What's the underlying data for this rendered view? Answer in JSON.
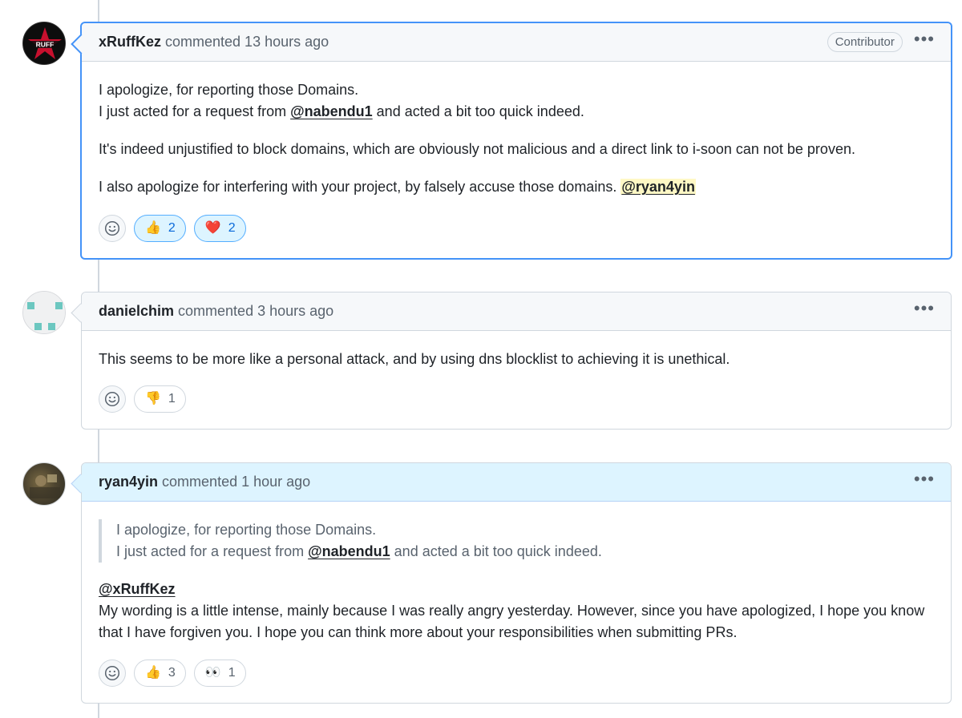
{
  "comments": [
    {
      "author": "xRuffKez",
      "meta": "commented 13 hours ago",
      "badge": "Contributor",
      "avatar_text": "RUFF",
      "lines": {
        "p1_line1": "I apologize, for reporting those Domains.",
        "p1_line2_pre": "I just acted for a request from ",
        "p1_mention": "@nabendu1",
        "p1_line2_post": " and acted a bit too quick indeed.",
        "p2": "It's indeed unjustified to block domains, which are obviously not malicious and a direct link to i-soon can not be proven.",
        "p3_pre": "I also apologize for interfering with your project, by falsely accuse those domains. ",
        "p3_mention": "@ryan4yin"
      },
      "reactions": [
        {
          "emoji": "👍",
          "count": "2"
        },
        {
          "emoji": "❤️",
          "count": "2"
        }
      ]
    },
    {
      "author": "danielchim",
      "meta": "commented 3 hours ago",
      "lines": {
        "p1": "This seems to be more like a personal attack, and by using dns blocklist to achieving it is unethical."
      },
      "reactions": [
        {
          "emoji": "👎",
          "count": "1"
        }
      ]
    },
    {
      "author": "ryan4yin",
      "meta": "commented 1 hour ago",
      "lines": {
        "quote_line1": "I apologize, for reporting those Domains.",
        "quote_line2_pre": "I just acted for a request from ",
        "quote_mention": "@nabendu1",
        "quote_line2_post": " and acted a bit too quick indeed.",
        "mention": "@xRuffKez",
        "body": "My wording is a little intense, mainly because I was really angry yesterday. However, since you have apologized, I hope you know that I have forgiven you. I hope you can think more about your responsibilities when submitting PRs."
      },
      "reactions": [
        {
          "emoji": "👍",
          "count": "3"
        },
        {
          "emoji": "👀",
          "count": "1"
        }
      ]
    }
  ],
  "icons": {
    "add_reaction": "smiley-icon",
    "more": "kebab-horizontal-icon"
  },
  "kebab_glyph": "•••",
  "colors": {
    "accent_blue": "#4493f8",
    "reaction_active_bg": "#ddf4ff",
    "mention_highlight": "#fff8c5",
    "owner_header_bg": "#ddf4ff"
  }
}
